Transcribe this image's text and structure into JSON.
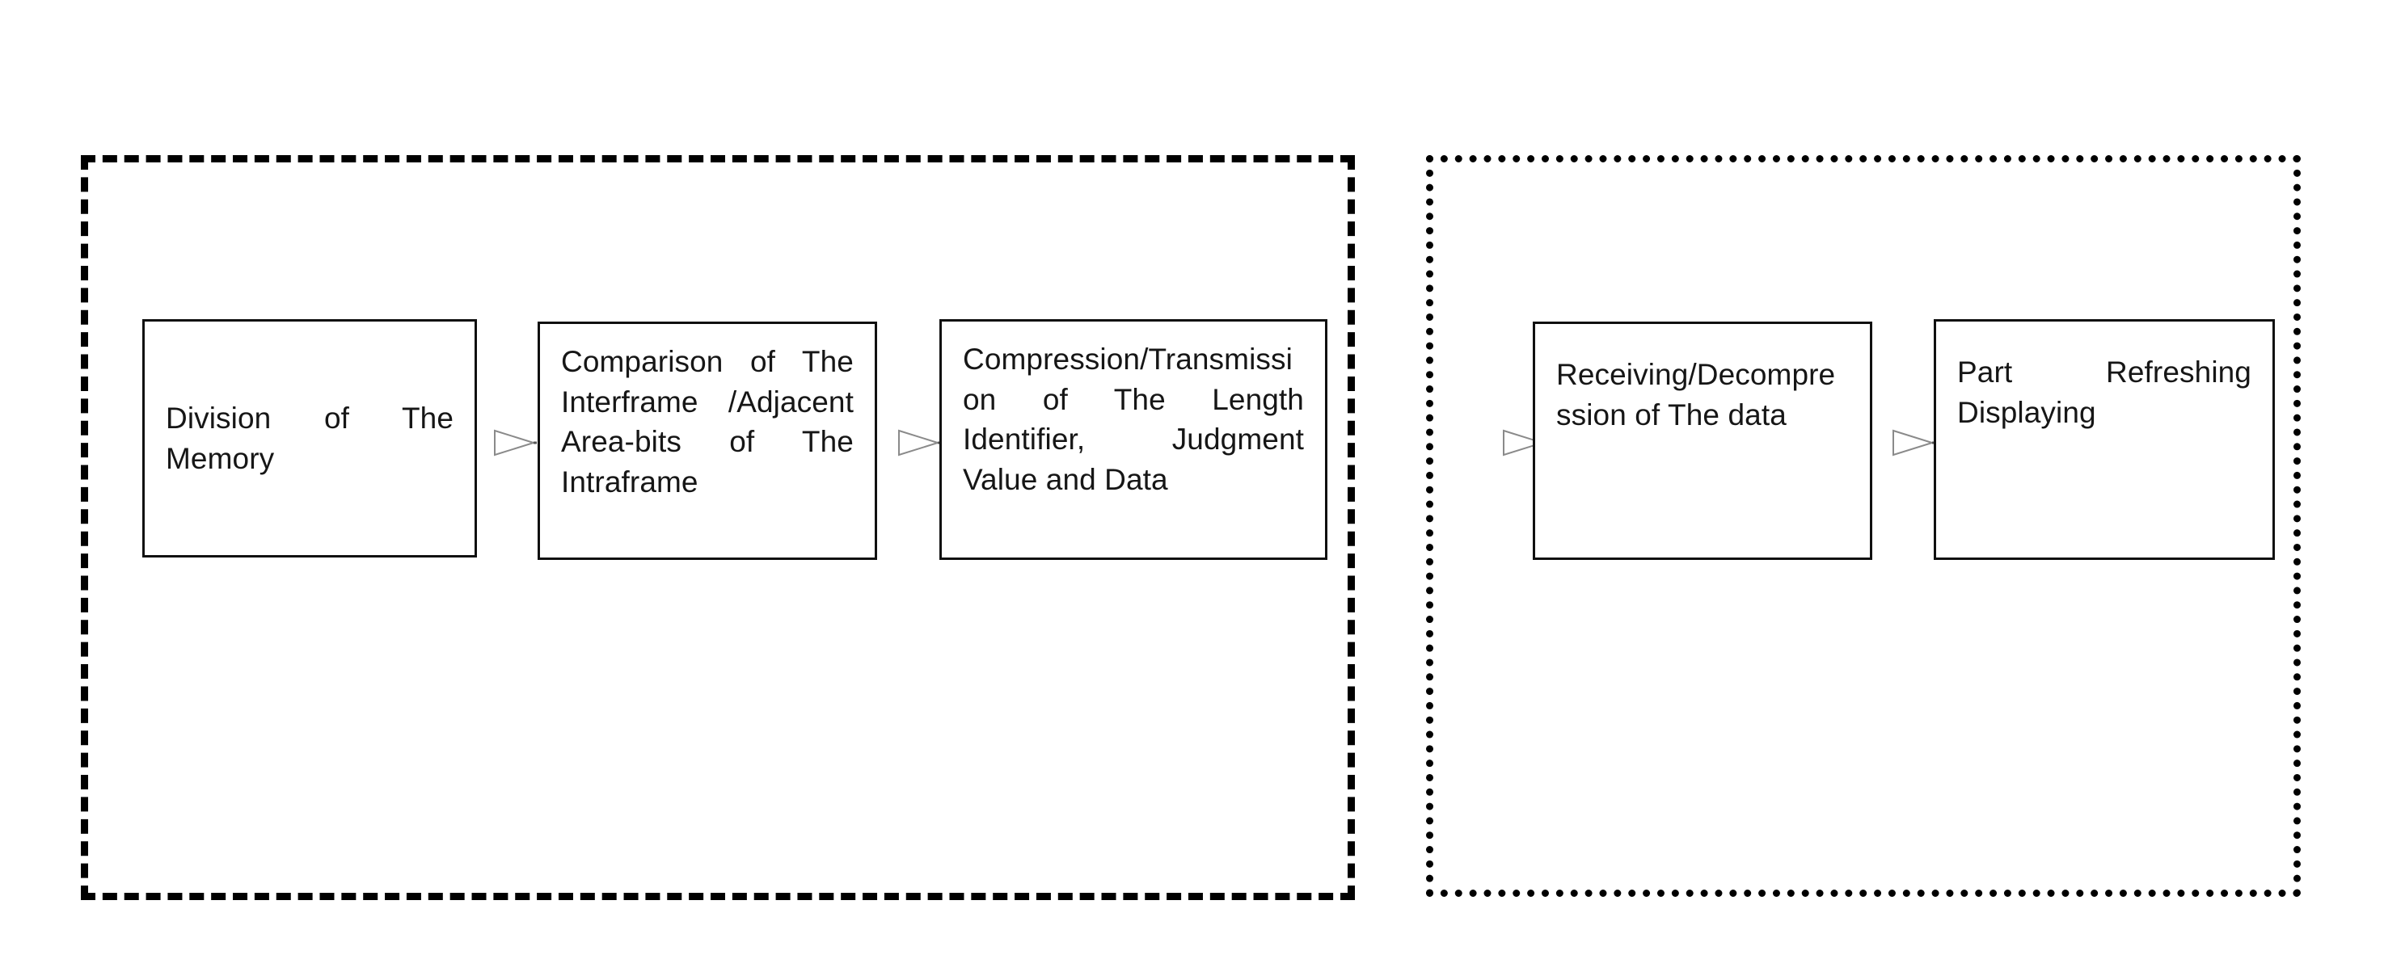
{
  "diagram": {
    "title_visible": false,
    "background_color": "#ffffff",
    "line_color": "#000000",
    "text_color": "#161616",
    "groups": [
      {
        "id": "transmitter-group",
        "name": "left-dashed-group",
        "border_style": "dashed",
        "label": ""
      },
      {
        "id": "receiver-group",
        "name": "right-dotted-group",
        "border_style": "dotted",
        "label": ""
      }
    ],
    "boxes": [
      {
        "id": "box-division-memory",
        "text": "Division of The Memory"
      },
      {
        "id": "box-comparison-interframe",
        "text": "Comparison of The Interframe /Adjacent Area-bits of The Intraframe"
      },
      {
        "id": "box-compression-transmission",
        "text": "Compression/Transmission of The Length Identifier, Judgment Value and Data"
      },
      {
        "id": "box-receiving-decompression",
        "text": "Receiving/Decompression of The data"
      },
      {
        "id": "box-part-refreshing",
        "text": "Part Refreshing Displaying"
      }
    ],
    "arrows": [
      {
        "id": "arrow-1",
        "from": "box-division-memory",
        "to": "box-comparison-interframe",
        "direction": "right"
      },
      {
        "id": "arrow-2",
        "from": "box-comparison-interframe",
        "to": "box-compression-transmission",
        "direction": "right"
      },
      {
        "id": "arrow-3",
        "from": "box-compression-transmission",
        "to": "box-receiving-decompression",
        "direction": "right"
      },
      {
        "id": "arrow-4",
        "from": "box-receiving-decompression",
        "to": "box-part-refreshing",
        "direction": "right"
      }
    ]
  }
}
